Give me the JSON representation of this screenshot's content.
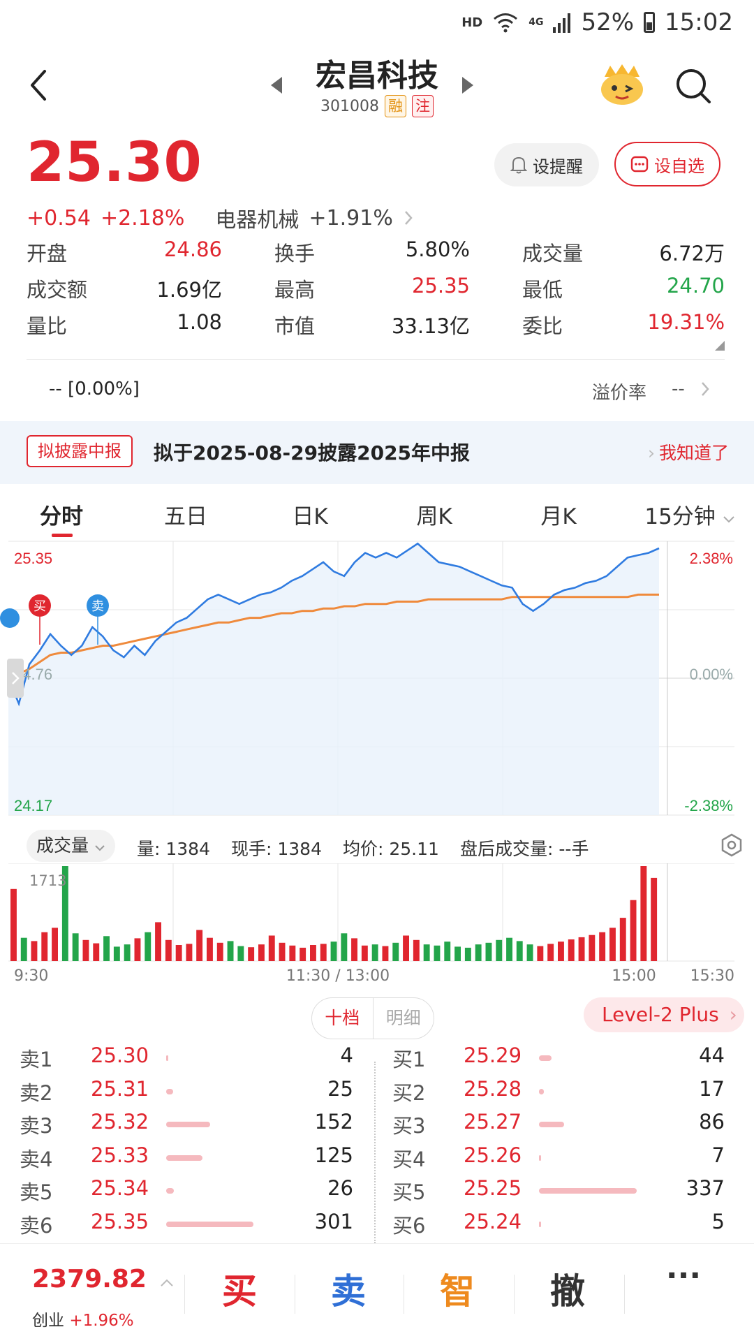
{
  "status_bar": {
    "hd": "HD",
    "network": "4G",
    "battery": "52%",
    "time": "15:02"
  },
  "header": {
    "title": "宏昌科技",
    "code": "301008",
    "tag_margin": "融",
    "tag_watch": "注"
  },
  "quote": {
    "price": "25.30",
    "change": "+0.54",
    "change_pct": "+2.18%",
    "sector": "电器机械",
    "sector_pct": "+1.91%",
    "remind_label": "设提醒",
    "fav_label": "设自选"
  },
  "stats": [
    [
      {
        "label": "开盘",
        "value": "24.86",
        "color": "red"
      },
      {
        "label": "换手",
        "value": "5.80%",
        "color": "dark"
      },
      {
        "label": "成交量",
        "value": "6.72万",
        "color": "dark"
      }
    ],
    [
      {
        "label": "成交额",
        "value": "1.69亿",
        "color": "dark"
      },
      {
        "label": "最高",
        "value": "25.35",
        "color": "red"
      },
      {
        "label": "最低",
        "value": "24.70",
        "color": "green"
      }
    ],
    [
      {
        "label": "量比",
        "value": "1.08",
        "color": "dark"
      },
      {
        "label": "市值",
        "value": "33.13亿",
        "color": "dark"
      },
      {
        "label": "委比",
        "value": "19.31%",
        "color": "red"
      }
    ]
  ],
  "premium": {
    "left": "-- [0.00%]",
    "label": "溢价率",
    "value": "--"
  },
  "notice": {
    "tag": "拟披露中报",
    "text": "拟于2025-08-29披露2025年中报",
    "action": "我知道了"
  },
  "tabs": [
    "分时",
    "五日",
    "日K",
    "周K",
    "月K",
    "15分钟"
  ],
  "chart_labels": {
    "y_top": "25.35",
    "y_mid": "24.76",
    "y_bottom": "24.17",
    "pct_top": "2.38%",
    "pct_mid": "0.00%",
    "pct_bottom": "-2.38%",
    "buy_marker": "买",
    "sell_marker": "卖",
    "vol_max": "1713",
    "x_start": "9:30",
    "x_mid": "11:30 / 13:00",
    "x_1500": "15:00",
    "x_end": "15:30"
  },
  "volume_bar": {
    "selector": "成交量",
    "vol": "量: 1384",
    "now": "现手: 1384",
    "avg": "均价: 25.11",
    "after": "盘后成交量: --手"
  },
  "orderbook": {
    "toggle_on": "十档",
    "toggle_off": "明细",
    "level2": "Level-2 Plus",
    "sell": [
      {
        "label": "卖1",
        "price": "25.30",
        "vol": "4",
        "amount": 4
      },
      {
        "label": "卖2",
        "price": "25.31",
        "vol": "25",
        "amount": 25
      },
      {
        "label": "卖3",
        "price": "25.32",
        "vol": "152",
        "amount": 152
      },
      {
        "label": "卖4",
        "price": "25.33",
        "vol": "125",
        "amount": 125
      },
      {
        "label": "卖5",
        "price": "25.34",
        "vol": "26",
        "amount": 26
      },
      {
        "label": "卖6",
        "price": "25.35",
        "vol": "301",
        "amount": 301
      }
    ],
    "buy": [
      {
        "label": "买1",
        "price": "25.29",
        "vol": "44",
        "amount": 44
      },
      {
        "label": "买2",
        "price": "25.28",
        "vol": "17",
        "amount": 17
      },
      {
        "label": "买3",
        "price": "25.27",
        "vol": "86",
        "amount": 86
      },
      {
        "label": "买4",
        "price": "25.26",
        "vol": "7",
        "amount": 7
      },
      {
        "label": "买5",
        "price": "25.25",
        "vol": "337",
        "amount": 337
      },
      {
        "label": "买6",
        "price": "25.24",
        "vol": "5",
        "amount": 5
      }
    ]
  },
  "bottom": {
    "index_value": "2379.82",
    "index_name": "创业",
    "index_pct": "+1.96%",
    "buy": "买",
    "sell": "卖",
    "smart": "智",
    "cancel": "撤",
    "more": "···"
  },
  "colors": {
    "accent": "#e0262f",
    "up": "#e0262f",
    "down": "#23a54a",
    "price_line": "#2f7be0",
    "avg_line": "#ef8a3c",
    "sell_button": "#2f6fd6",
    "smart_button": "#ee8a1e"
  },
  "chart_data": {
    "type": "line",
    "y_range": [
      24.17,
      25.35
    ],
    "prev_close": 24.76,
    "price": [
      24.76,
      24.65,
      24.82,
      24.88,
      24.95,
      24.9,
      24.86,
      24.9,
      24.98,
      24.94,
      24.88,
      24.85,
      24.9,
      24.86,
      24.92,
      24.96,
      25.0,
      25.02,
      25.06,
      25.1,
      25.12,
      25.1,
      25.08,
      25.1,
      25.12,
      25.13,
      25.15,
      25.18,
      25.2,
      25.23,
      25.26,
      25.22,
      25.2,
      25.26,
      25.3,
      25.28,
      25.3,
      25.28,
      25.31,
      25.34,
      25.3,
      25.26,
      25.25,
      25.24,
      25.22,
      25.2,
      25.18,
      25.16,
      25.15,
      25.08,
      25.05,
      25.08,
      25.12,
      25.14,
      25.15,
      25.17,
      25.18,
      25.2,
      25.24,
      25.28,
      25.29,
      25.3,
      25.32
    ],
    "avg": [
      24.76,
      24.78,
      24.8,
      24.83,
      24.86,
      24.87,
      24.87,
      24.88,
      24.89,
      24.9,
      24.9,
      24.91,
      24.92,
      24.93,
      24.94,
      24.95,
      24.96,
      24.97,
      24.98,
      24.99,
      25.0,
      25.0,
      25.01,
      25.02,
      25.02,
      25.03,
      25.04,
      25.04,
      25.05,
      25.05,
      25.06,
      25.06,
      25.07,
      25.07,
      25.08,
      25.08,
      25.08,
      25.09,
      25.09,
      25.09,
      25.1,
      25.1,
      25.1,
      25.1,
      25.1,
      25.1,
      25.1,
      25.1,
      25.11,
      25.11,
      25.11,
      25.11,
      25.11,
      25.11,
      25.11,
      25.11,
      25.11,
      25.11,
      25.11,
      25.11,
      25.12,
      25.12,
      25.12
    ],
    "volume": [
      1300,
      420,
      360,
      520,
      600,
      1713,
      500,
      380,
      320,
      450,
      260,
      300,
      410,
      520,
      700,
      380,
      290,
      310,
      560,
      420,
      330,
      360,
      270,
      250,
      300,
      460,
      330,
      280,
      240,
      290,
      310,
      350,
      500,
      410,
      280,
      300,
      270,
      330,
      460,
      380,
      300,
      280,
      350,
      260,
      240,
      300,
      330,
      380,
      420,
      360,
      300,
      270,
      310,
      350,
      390,
      430,
      470,
      520,
      600,
      780,
      1100,
      1713,
      1500
    ],
    "volume_max": 1713
  }
}
